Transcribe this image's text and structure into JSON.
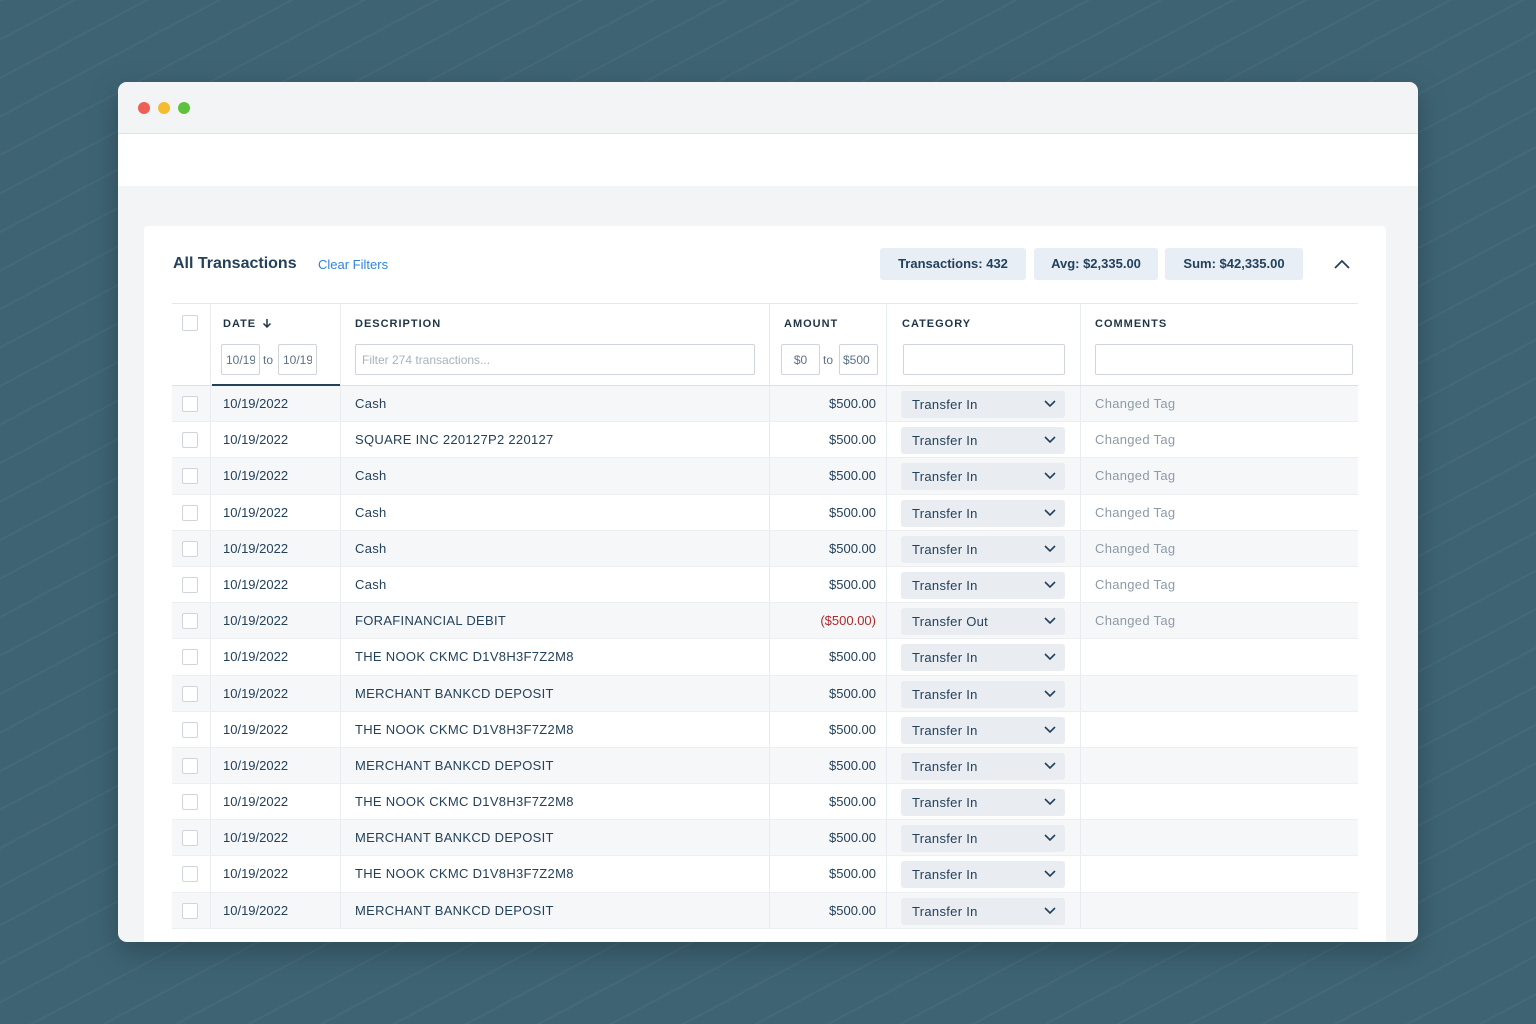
{
  "window": {
    "controls": [
      "close",
      "minimize",
      "maximize"
    ]
  },
  "card": {
    "title": "All Transactions",
    "clear_filters": "Clear Filters",
    "stats": {
      "transactions": "Transactions: 432",
      "avg": "Avg: $2,335.00",
      "sum": "Sum: $42,335.00"
    },
    "collapse_icon": "chevron-up-icon"
  },
  "table": {
    "headers": {
      "date": "DATE",
      "description": "DESCRIPTION",
      "amount": "AMOUNT",
      "category": "CATEGORY",
      "comments": "COMMENTS"
    },
    "filters": {
      "date_from": "10/19",
      "date_to": "10/19",
      "to_label": "to",
      "description_placeholder": "Filter 274 transactions...",
      "amount_from": "$0",
      "amount_to": "$500",
      "category": "",
      "comments": ""
    },
    "rows": [
      {
        "date": "10/19/2022",
        "description": "Cash",
        "amount": "$500.00",
        "category": "Transfer In",
        "comment": "Changed Tag"
      },
      {
        "date": "10/19/2022",
        "description": "SQUARE INC 220127P2 220127",
        "amount": "$500.00",
        "category": "Transfer In",
        "comment": "Changed Tag"
      },
      {
        "date": "10/19/2022",
        "description": "Cash",
        "amount": "$500.00",
        "category": "Transfer In",
        "comment": "Changed Tag"
      },
      {
        "date": "10/19/2022",
        "description": "Cash",
        "amount": "$500.00",
        "category": "Transfer In",
        "comment": "Changed Tag"
      },
      {
        "date": "10/19/2022",
        "description": "Cash",
        "amount": "$500.00",
        "category": "Transfer In",
        "comment": "Changed Tag"
      },
      {
        "date": "10/19/2022",
        "description": "Cash",
        "amount": "$500.00",
        "category": "Transfer In",
        "comment": "Changed Tag"
      },
      {
        "date": "10/19/2022",
        "description": "FORAFINANCIAL DEBIT",
        "amount": "($500.00)",
        "category": "Transfer Out",
        "comment": "Changed Tag",
        "negative": true
      },
      {
        "date": "10/19/2022",
        "description": "THE NOOK CKMC D1V8H3F7Z2M8",
        "amount": "$500.00",
        "category": "Transfer In",
        "comment": ""
      },
      {
        "date": "10/19/2022",
        "description": "MERCHANT BANKCD DEPOSIT",
        "amount": "$500.00",
        "category": "Transfer In",
        "comment": ""
      },
      {
        "date": "10/19/2022",
        "description": "THE NOOK CKMC D1V8H3F7Z2M8",
        "amount": "$500.00",
        "category": "Transfer In",
        "comment": ""
      },
      {
        "date": "10/19/2022",
        "description": "MERCHANT BANKCD DEPOSIT",
        "amount": "$500.00",
        "category": "Transfer In",
        "comment": ""
      },
      {
        "date": "10/19/2022",
        "description": "THE NOOK CKMC D1V8H3F7Z2M8",
        "amount": "$500.00",
        "category": "Transfer In",
        "comment": ""
      },
      {
        "date": "10/19/2022",
        "description": "MERCHANT BANKCD DEPOSIT",
        "amount": "$500.00",
        "category": "Transfer In",
        "comment": ""
      },
      {
        "date": "10/19/2022",
        "description": "THE NOOK CKMC D1V8H3F7Z2M8",
        "amount": "$500.00",
        "category": "Transfer In",
        "comment": ""
      },
      {
        "date": "10/19/2022",
        "description": "MERCHANT BANKCD DEPOSIT",
        "amount": "$500.00",
        "category": "Transfer In",
        "comment": ""
      }
    ],
    "sort_icon": "arrow-down-icon",
    "row_dropdown_icon": "chevron-down-icon"
  },
  "colors": {
    "background": "#3e6474",
    "accent_link": "#2f86d8",
    "text_primary": "#24415a",
    "negative_amount": "#b02a2a",
    "stat_badge": "#e7eef5"
  }
}
